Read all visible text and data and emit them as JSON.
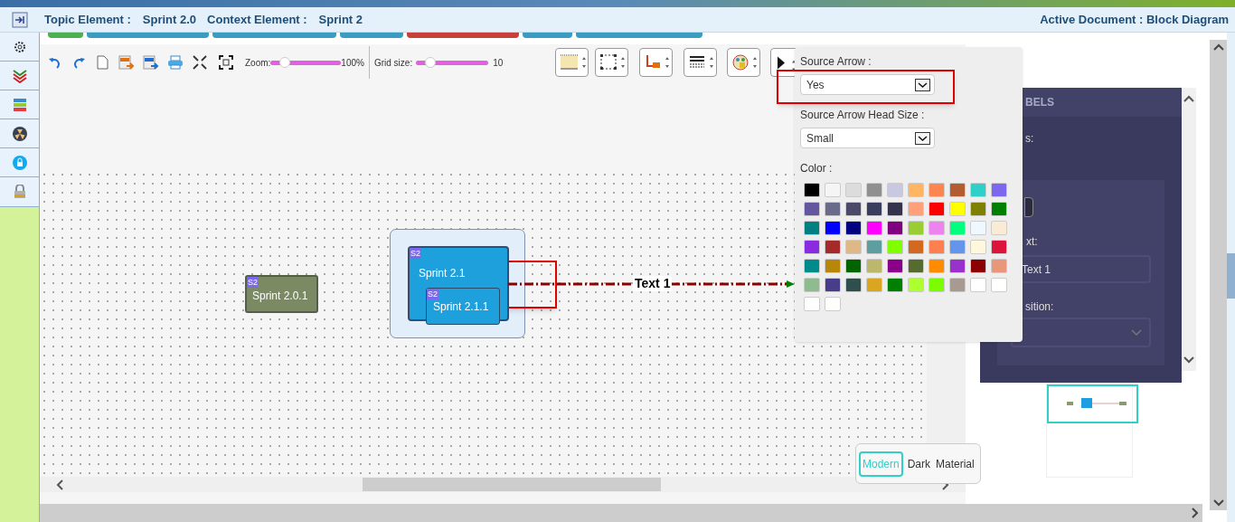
{
  "header": {
    "topic_label": "Topic Element :",
    "topic_value": "Sprint 2.0",
    "context_label": "Context Element :",
    "context_value": "Sprint 2",
    "active_document": "Active Document : Block Diagram"
  },
  "toolbar": {
    "zoom": {
      "label": "Zoom:",
      "level": 0.2,
      "reading": "100%"
    },
    "grid_size": {
      "label": "Grid size:",
      "level": 0.2,
      "reading": "10"
    }
  },
  "canvas": {
    "nodes": [
      {
        "badge": "S2",
        "label": "Sprint 2.0.1",
        "kind": "olive"
      },
      {
        "badge": "S2",
        "label": "Sprint 2.1",
        "kind": "parent"
      },
      {
        "badge": "S2",
        "label": "Sprint 2.1.1",
        "kind": "child"
      }
    ],
    "connector_label": "Text 1"
  },
  "popup": {
    "source_arrow": {
      "label": "Source Arrow :",
      "value": "Yes"
    },
    "head_size": {
      "label": "Source Arrow Head Size :",
      "value": "Small"
    },
    "color_label": "Color :",
    "swatches": [
      {
        "color": "#000000"
      },
      {
        "color": "#f5f5f5"
      },
      {
        "color": "#dcdcdc"
      },
      {
        "color": "#909090"
      },
      {
        "color": "#c8c8e0"
      },
      {
        "color": "#ffb562"
      },
      {
        "color": "#ff8550"
      },
      {
        "color": "#b35c32"
      },
      {
        "color": "#2ed0c8"
      },
      {
        "color": "#7b68ee"
      },
      {
        "color": "#6556a0"
      },
      {
        "color": "#6a6a8a"
      },
      {
        "color": "#4a4a68"
      },
      {
        "color": "#3a3d5c"
      },
      {
        "color": "#33334e"
      },
      {
        "color": "#ffa07a"
      },
      {
        "color": "#ff0000"
      },
      {
        "color": "#ffff00"
      },
      {
        "color": "#808000"
      },
      {
        "color": "#008000"
      },
      {
        "color": "#008080"
      },
      {
        "color": "#0000ff"
      },
      {
        "color": "#000080"
      },
      {
        "color": "#ff00ff"
      },
      {
        "color": "#800080"
      },
      {
        "color": "#9acd32"
      },
      {
        "color": "#ee82ee"
      },
      {
        "color": "#00ff7f"
      },
      {
        "color": "#f0f8ff"
      },
      {
        "color": "#faebd7"
      },
      {
        "color": "#8a2be2"
      },
      {
        "color": "#a52a2a"
      },
      {
        "color": "#deb887"
      },
      {
        "color": "#5f9ea0"
      },
      {
        "color": "#7fff00"
      },
      {
        "color": "#d2691e"
      },
      {
        "color": "#ff7f50"
      },
      {
        "color": "#6495ed"
      },
      {
        "color": "#fff8dc"
      },
      {
        "color": "#dc143c"
      },
      {
        "color": "#008b8b"
      },
      {
        "color": "#b8860b"
      },
      {
        "color": "#006400"
      },
      {
        "color": "#bdb76b"
      },
      {
        "color": "#8b008b"
      },
      {
        "color": "#556b2f"
      },
      {
        "color": "#ff8c00"
      },
      {
        "color": "#9932cc"
      },
      {
        "color": "#8b0000"
      },
      {
        "color": "#e9967a"
      },
      {
        "color": "#8fbc8f"
      },
      {
        "color": "#483d8b"
      },
      {
        "color": "#2f4f4f"
      },
      {
        "color": "#daa520"
      },
      {
        "color": "#008001"
      },
      {
        "color": "#adff2f"
      },
      {
        "color": "#7cfc00"
      },
      {
        "color": "#a89a90"
      },
      {
        "color": "#ffffff"
      },
      {
        "color": "#fffffe"
      },
      {
        "color": "#fffffd"
      },
      {
        "color": "#fffffc"
      }
    ]
  },
  "side_panel": {
    "heading": "BELS",
    "field_1_label": "s:",
    "field_2_label": "xt:",
    "text_value": "Text 1",
    "field_3_label": "sition:"
  },
  "themes": [
    {
      "label": "Modern",
      "selected": true
    },
    {
      "label": "Dark",
      "selected": false
    },
    {
      "label": "Material",
      "selected": false
    }
  ]
}
